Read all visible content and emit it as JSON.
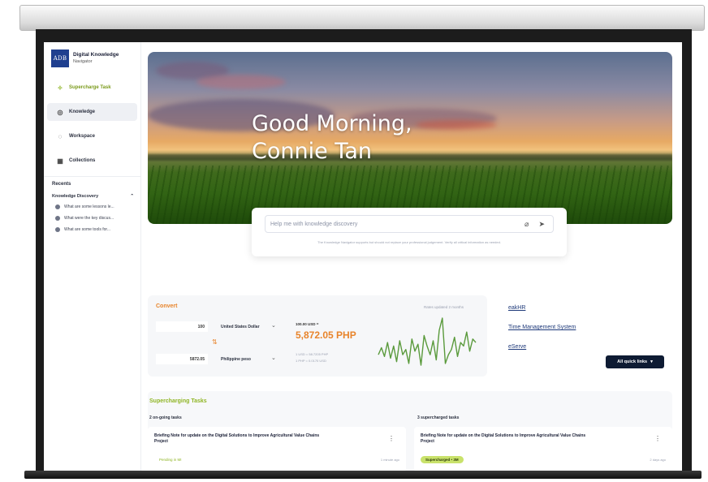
{
  "sidebar": {
    "logo_text": "ADB",
    "app_name": "Digital Knowledge",
    "app_sub": "Navigator",
    "nav": [
      {
        "label": "Supercharge Task",
        "icon": "sparkle-icon"
      },
      {
        "label": "Knowledge",
        "icon": "compass-icon"
      },
      {
        "label": "Workspace",
        "icon": "chat-icon"
      },
      {
        "label": "Collections",
        "icon": "grid-icon"
      }
    ],
    "recents_title": "Recents",
    "group_title": "Knowledge Discovery",
    "recents": [
      "What are some lessons le...",
      "What were the key discus...",
      "What are some tools for..."
    ]
  },
  "hero": {
    "greeting_line1": "Good Morning,",
    "greeting_line2": "Connie Tan"
  },
  "search": {
    "placeholder": "Help me with knowledge discovery",
    "disclaimer": "The Knowledge Navigator supports but should not replace your professional judgement. Verify all critical information as needed."
  },
  "convert": {
    "title": "Convert",
    "updated": "Rates updated 2 months",
    "from_amount": "100",
    "from_currency": "United States Dollar",
    "to_amount": "5872.05",
    "to_currency": "Philippine peso",
    "rate_small": "100.00 USD =",
    "rate_big": "5,872.05 PHP",
    "note1": "1 USD = 58.7205 PHP",
    "note2": "1 PHP = 0.0170 USD",
    "chart_series": [
      30,
      38,
      28,
      44,
      26,
      40,
      22,
      46,
      30,
      36,
      20,
      48,
      34,
      42,
      18,
      52,
      40,
      30,
      46,
      24,
      58,
      72,
      20,
      30,
      36,
      50,
      28,
      44,
      40,
      56,
      34,
      48,
      44
    ]
  },
  "quick_links": {
    "links": [
      "eakHR",
      "Time Management System",
      "eServe"
    ],
    "all_label": "All quick links"
  },
  "tasks": {
    "title": "Supercharging Tasks",
    "ongoing_title": "2 on-going tasks",
    "done_title": "3 supercharged tasks",
    "ongoing": {
      "text": "Briefing Note for update on the Digital Solutions to Improve Agricultural Value Chains Project",
      "status": "Pending in MI",
      "time": "1 minute ago"
    },
    "done": {
      "text": "Briefing Note for update on the Digital Solutions to Improve Agricultural Value Chains Project",
      "status": "Supercharged • 3M",
      "time": "2 days ago"
    }
  },
  "colors": {
    "accent_orange": "#e8842b",
    "accent_green": "#8fb524",
    "brand_blue": "#1f3f8f",
    "button_dark": "#0e1b33"
  }
}
